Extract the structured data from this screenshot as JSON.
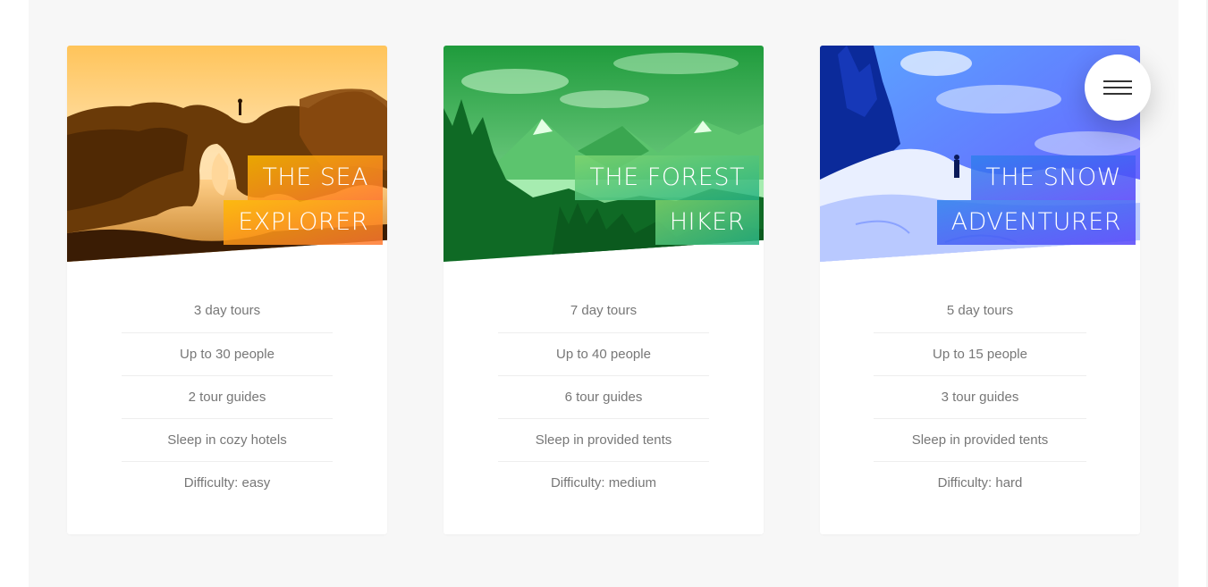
{
  "navigation": {
    "menu_icon": "hamburger-icon"
  },
  "colors": {
    "section_background": "#f7f7f7",
    "card_background": "#ffffff",
    "detail_text": "#777777",
    "orange_gradient": [
      "#ffb900",
      "#ff7730"
    ],
    "green_gradient": [
      "#7ed56f",
      "#28b485"
    ],
    "blue_gradient": [
      "#2f80ed",
      "#5643fa"
    ]
  },
  "cards": [
    {
      "theme": "orange",
      "heading": {
        "line1": "THE SEA",
        "line2": "EXPLORER"
      },
      "details": [
        "3 day tours",
        "Up to 30 people",
        "2 tour guides",
        "Sleep in cozy hotels",
        "Difficulty: easy"
      ]
    },
    {
      "theme": "green",
      "heading": {
        "line1": "THE FOREST",
        "line2": "HIKER"
      },
      "details": [
        "7 day tours",
        "Up to 40 people",
        "6 tour guides",
        "Sleep in provided tents",
        "Difficulty: medium"
      ]
    },
    {
      "theme": "blue",
      "heading": {
        "line1": "THE SNOW",
        "line2": "ADVENTURER"
      },
      "details": [
        "5 day tours",
        "Up to 15 people",
        "3 tour guides",
        "Sleep in provided tents",
        "Difficulty: hard"
      ]
    }
  ]
}
